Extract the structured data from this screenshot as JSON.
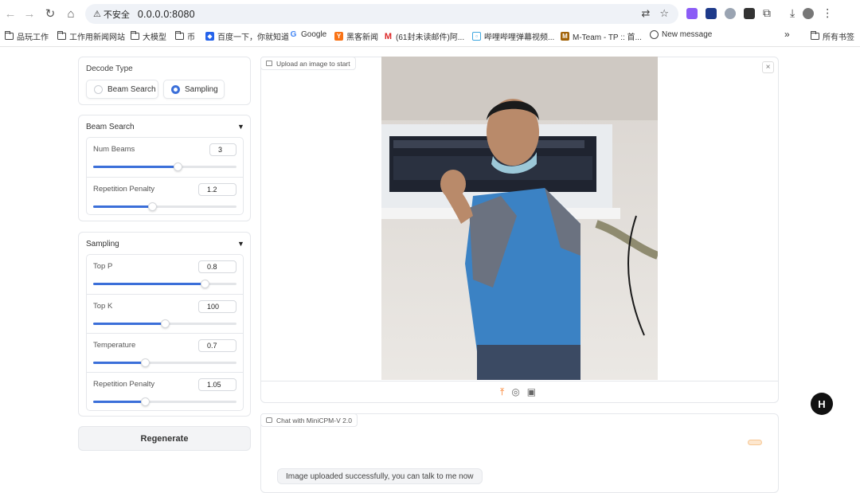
{
  "browser": {
    "security_label": "不安全",
    "url": "0.0.0.0:8080",
    "bookmarks": [
      {
        "label": "品玩工作",
        "icon": "folder-icon"
      },
      {
        "label": "工作用新闻网站",
        "icon": "folder-icon"
      },
      {
        "label": "大模型",
        "icon": "folder-icon"
      },
      {
        "label": "币",
        "icon": "folder-icon"
      },
      {
        "label": "百度一下，你就知道",
        "icon": "baidu-icon"
      },
      {
        "label": "Google",
        "icon": "google-icon"
      },
      {
        "label": "黑客新闻",
        "icon": "hackernews-icon"
      },
      {
        "label": "(61封未读邮件)阿...",
        "icon": "gmail-icon"
      },
      {
        "label": "哔哩哔哩弹幕视频...",
        "icon": "bilibili-icon"
      },
      {
        "label": "M-Team - TP :: 首...",
        "icon": "mteam-icon"
      },
      {
        "label": "New message",
        "icon": "globe-icon"
      }
    ],
    "more_bookmarks": "»",
    "all_bookmarks": "所有书签"
  },
  "decode": {
    "title": "Decode Type",
    "options": [
      {
        "label": "Beam Search",
        "selected": false
      },
      {
        "label": "Sampling",
        "selected": true
      }
    ]
  },
  "beam_search": {
    "title": "Beam Search",
    "params": [
      {
        "label": "Num Beams",
        "value": "3",
        "fraction": 0.59
      },
      {
        "label": "Repetition Penalty",
        "value": "1.2",
        "fraction": 0.41
      }
    ]
  },
  "sampling": {
    "title": "Sampling",
    "params": [
      {
        "label": "Top P",
        "value": "0.8",
        "fraction": 0.78
      },
      {
        "label": "Top K",
        "value": "100",
        "fraction": 0.5
      },
      {
        "label": "Temperature",
        "value": "0.7",
        "fraction": 0.36
      },
      {
        "label": "Repetition Penalty",
        "value": "1.05",
        "fraction": 0.36
      }
    ]
  },
  "regenerate_label": "Regenerate",
  "image_panel": {
    "label": "Upload an image to start",
    "close": "×"
  },
  "chat": {
    "label": "Chat with MiniCPM-V 2.0",
    "message": "Image uploaded successfully, you can talk to me now"
  },
  "badge": "H",
  "colors": {
    "accent": "#3b6fd9",
    "upload_icon": "#f97316"
  }
}
